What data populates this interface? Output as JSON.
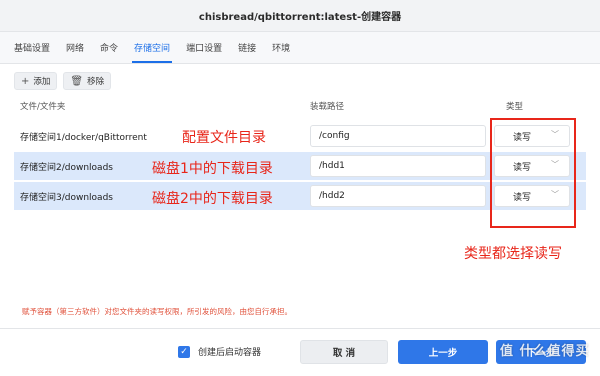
{
  "window": {
    "title": "chisbread/qbittorrent:latest-创建容器"
  },
  "tabs": [
    {
      "label": "基础设置"
    },
    {
      "label": "网络"
    },
    {
      "label": "命令"
    },
    {
      "label": "存储空间"
    },
    {
      "label": "端口设置"
    },
    {
      "label": "链接"
    },
    {
      "label": "环境"
    }
  ],
  "toolbar": {
    "add_label": "添加",
    "remove_label": "移除"
  },
  "columns": {
    "folder": "文件/文件夹",
    "mount": "装载路径",
    "type": "类型"
  },
  "rows": [
    {
      "path": "存储空间1/docker/qBittorrent",
      "mount": "/config",
      "type": "读写"
    },
    {
      "path": "存储空间2/downloads",
      "mount": "/hdd1",
      "type": "读写"
    },
    {
      "path": "存储空间3/downloads",
      "mount": "/hdd2",
      "type": "读写"
    }
  ],
  "annotations": {
    "config_dir": "配置文件目录",
    "disk1_dir": "磁盘1中的下载目录",
    "disk2_dir": "磁盘2中的下载目录",
    "type_note": "类型都选择读写",
    "color": "#e8261a"
  },
  "disclaimer": "赋予容器（第三方软件）对您文件夹的读写权限，所引发的风险，由您自行承担。",
  "footer": {
    "autostart_label": "创建后启动容器",
    "autostart_checked": true,
    "cancel_label": "取 消",
    "prev_label": "上一步",
    "next_label": "下一步"
  },
  "watermark": "值 什么值得买",
  "colors": {
    "accent": "#2f77e8",
    "selected_row": "#dbe8fb"
  }
}
